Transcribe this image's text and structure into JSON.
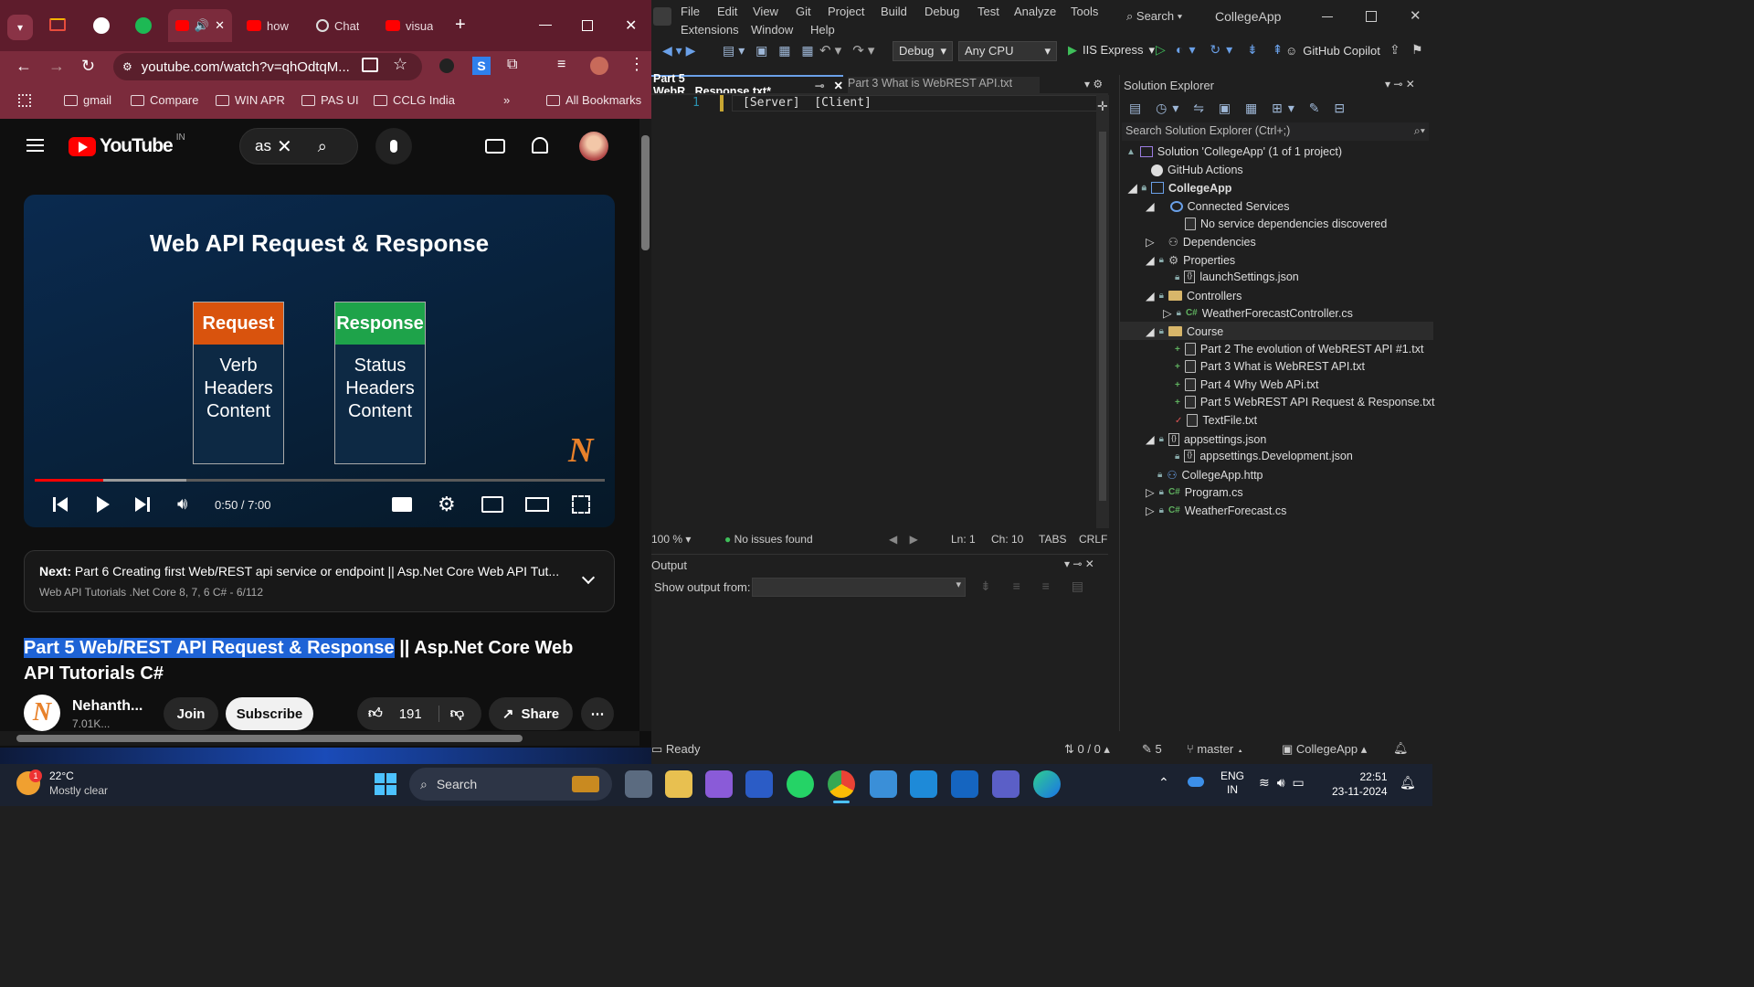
{
  "browser": {
    "tabs": [
      {
        "label": "how"
      },
      {
        "label": "Chat"
      },
      {
        "label": "visua"
      }
    ],
    "url": "youtube.com/watch?v=qhOdtqM...",
    "bookmarks": [
      "gmail",
      "Compare",
      "WIN APR",
      "PAS UI",
      "CCLG India"
    ],
    "all_bookmarks": "All Bookmarks",
    "more": "»"
  },
  "youtube": {
    "logo": "YouTube",
    "region": "IN",
    "search_value": "as",
    "video": {
      "slide_title": "Web API Request & Response",
      "request_label": "Request",
      "request_items": [
        "Verb",
        "Headers",
        "Content"
      ],
      "response_label": "Response",
      "response_items": [
        "Status",
        "Headers",
        "Content"
      ],
      "watermark": "N",
      "time": "0:50 / 7:00",
      "progress": 0.12
    },
    "next": {
      "prefix": "Next:",
      "title": "Part 6 Creating first Web/REST api service or endpoint || Asp.Net Core Web API Tut...",
      "playlist": "Web API Tutorials .Net Core 8, 7, 6 C# - 6/112"
    },
    "title_highlight": "Part 5 Web/REST API Request & Response",
    "title_rest": " || Asp.Net Core Web API Tutorials C#",
    "channel": {
      "name": "Nehanth...",
      "subs": "7.01K..."
    },
    "join": "Join",
    "subscribe": "Subscribe",
    "likes": "191",
    "share": "Share"
  },
  "vs": {
    "menu": [
      "File",
      "Edit",
      "View",
      "Git",
      "Project",
      "Build",
      "Debug",
      "Test",
      "Analyze",
      "Tools",
      "Extensions",
      "Window",
      "Help"
    ],
    "search": "Search",
    "app": "CollegeApp",
    "config": "Debug",
    "platform": "Any CPU",
    "run": "IIS Express",
    "copilot": "GitHub Copilot",
    "tabs": [
      "Part 5 WebR...Response.txt*",
      "Part 3 What is WebREST API.txt"
    ],
    "line_no": "1",
    "code": "[Server]  [Client]",
    "zoom": "100 %",
    "issues": "No issues found",
    "ln": "Ln: 1",
    "ch": "Ch: 10",
    "tabs_mode": "TABS",
    "eol": "CRLF",
    "output_title": "Output",
    "output_from": "Show output from:",
    "solution_explorer": "Solution Explorer",
    "search_sol": "Search Solution Explorer (Ctrl+;)",
    "tree": [
      "Solution 'CollegeApp' (1 of 1 project)",
      "GitHub Actions",
      "CollegeApp",
      "Connected Services",
      "No service dependencies discovered",
      "Dependencies",
      "Properties",
      "launchSettings.json",
      "Controllers",
      "WeatherForecastController.cs",
      "Course",
      "Part 2 The evolution of WebREST API #1.txt",
      "Part 3 What is WebREST API.txt",
      "Part 4 Why Web APi.txt",
      "Part 5 WebREST API Request & Response.txt",
      "TextFile.txt",
      "appsettings.json",
      "appsettings.Development.json",
      "CollegeApp.http",
      "Program.cs",
      "WeatherForecast.cs"
    ],
    "status": {
      "ready": "Ready",
      "updown": "0 / 0",
      "pencil": "5",
      "branch": "master",
      "repo": "CollegeApp"
    }
  },
  "taskbar": {
    "temp": "22°C",
    "weather": "Mostly clear",
    "search": "Search",
    "lang1": "ENG",
    "lang2": "IN",
    "time": "22:51",
    "date": "23-11-2024",
    "badge": "1"
  }
}
